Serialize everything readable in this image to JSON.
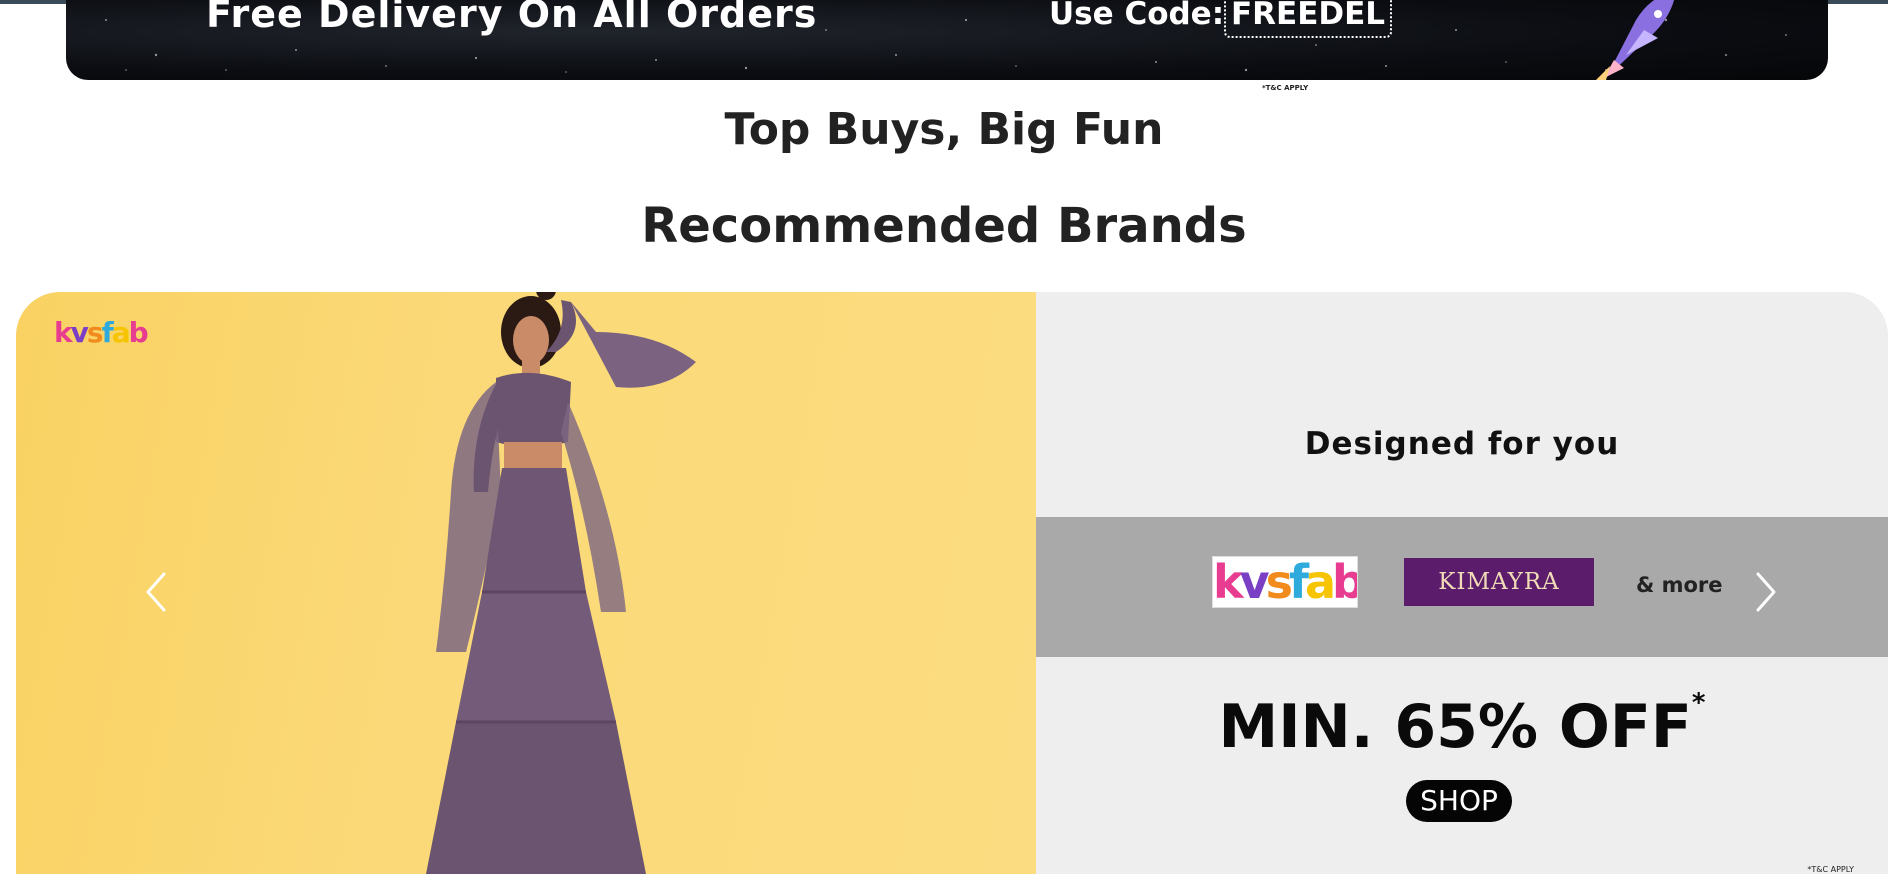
{
  "promo_banner": {
    "headline": "Free Delivery On All Orders",
    "code_label": "Use Code:",
    "code": "FREEDEL",
    "terms": "*T&C APPLY"
  },
  "sections": {
    "top_buys_title": "Top Buys, Big Fun",
    "recommended_title": "Recommended Brands"
  },
  "carousel": {
    "slide": {
      "corner_logo": "kvsfab",
      "tagline": "Designed for you",
      "brands": [
        "kvsfab",
        "KIMAYRA"
      ],
      "more_label": "& more",
      "offer": "MIN. 65% OFF",
      "offer_mark": "*",
      "cta": "SHOP",
      "terms": "*T&C APPLY"
    },
    "prev_icon": "chevron-left-icon",
    "next_icon": "chevron-right-icon"
  },
  "colors": {
    "banner_bg": "#0b0d12",
    "slide_left_bg": "#fbd978",
    "slide_right_bg": "#eeeeee",
    "logo_strip_bg": "#a9a9a9",
    "kimayra_bg": "#5a1c6b",
    "dress": "#6b5470"
  }
}
